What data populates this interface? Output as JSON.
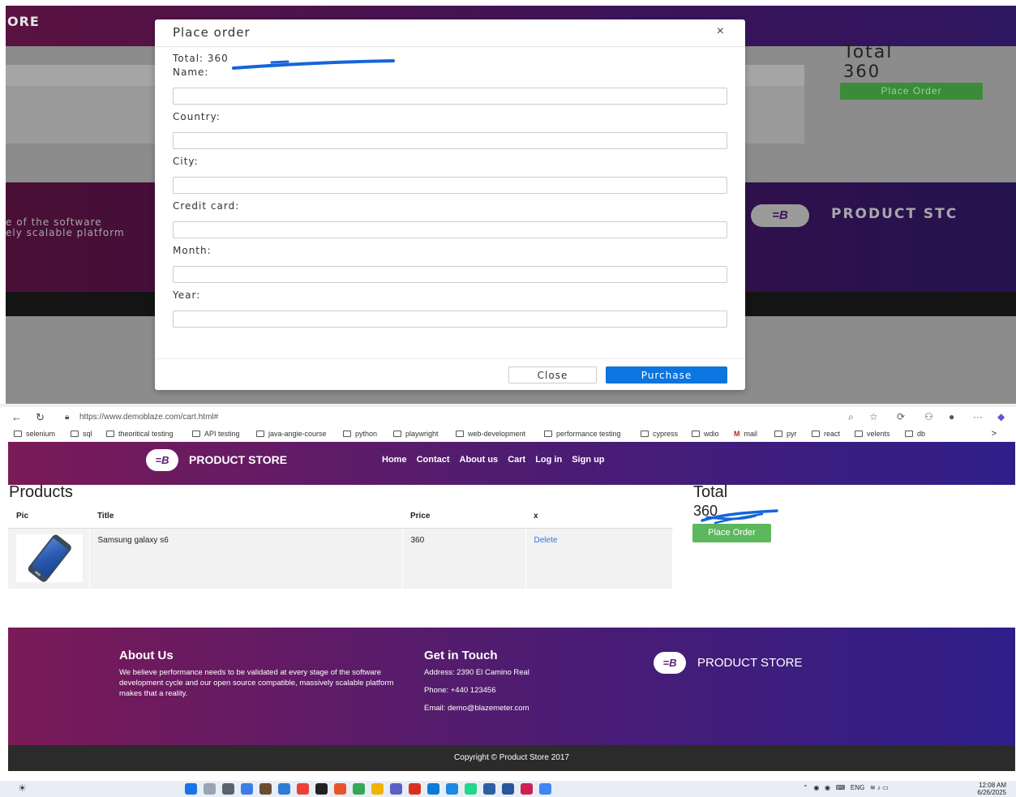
{
  "top": {
    "background": {
      "brand_fragment": "ORE",
      "total_label": "Total",
      "total_value": "360",
      "place_order": "Place Order",
      "footer_line1": "e of the software",
      "footer_line2": "ely scalable platform",
      "footer_brand": "PRODUCT STC"
    },
    "modal": {
      "title": "Place order",
      "close_x": "×",
      "total": "Total: 360",
      "fields": [
        {
          "label": "Name:",
          "value": ""
        },
        {
          "label": "Country:",
          "value": ""
        },
        {
          "label": "City:",
          "value": ""
        },
        {
          "label": "Credit card:",
          "value": ""
        },
        {
          "label": "Month:",
          "value": ""
        },
        {
          "label": "Year:",
          "value": ""
        }
      ],
      "close_button": "Close",
      "purchase_button": "Purchase"
    }
  },
  "browser": {
    "url": "https://www.demoblaze.com/cart.html#",
    "bookmarks": [
      "selenium",
      "sql",
      "theoritical testing",
      "API testing",
      "java-angie-course",
      "python",
      "playwright",
      "web-development",
      "performance testing",
      "cypress",
      "wdio",
      "mail",
      "pyr",
      "react",
      "velents",
      "db"
    ],
    "more": ">"
  },
  "site": {
    "logo_text": "B",
    "brand": "PRODUCT STORE",
    "nav": [
      "Home",
      "Contact",
      "About us",
      "Cart",
      "Log in",
      "Sign up"
    ],
    "products_title": "Products",
    "table_headers": [
      "Pic",
      "Title",
      "Price",
      "x"
    ],
    "rows": [
      {
        "title": "Samsung galaxy s6",
        "price": "360",
        "action": "Delete"
      }
    ],
    "total_title": "Total",
    "total_value": "360",
    "place_order": "Place Order",
    "footer": {
      "about_title": "About Us",
      "about_text": "We believe performance needs to be validated at every stage of the software development cycle and our open source compatible, massively scalable platform makes that a reality.",
      "contact_title": "Get in Touch",
      "address": "Address: 2390 El Camino Real",
      "phone": "Phone: +440 123456",
      "email": "Email: demo@blazemeter.com",
      "brand": "PRODUCT STORE"
    },
    "copyright": "Copyright © Product Store 2017"
  },
  "taskbar": {
    "lang": "ENG",
    "time": "12:08 AM",
    "date": "6/26/2025"
  },
  "colors": {
    "nav_gradient_start": "#7a1a57",
    "nav_gradient_end": "#2f1f8a",
    "purchase_blue": "#0b75e0",
    "place_order_green": "#5cb85c",
    "annotation_blue": "#1565d8"
  }
}
